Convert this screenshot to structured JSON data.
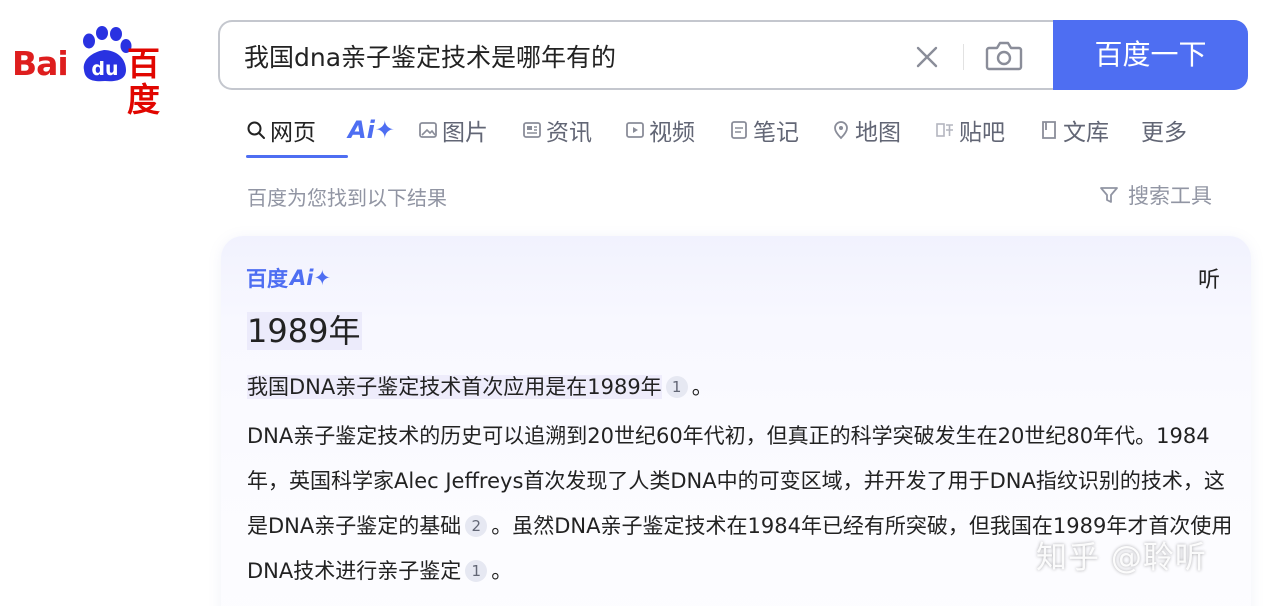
{
  "logo": {
    "bai": "Bai",
    "du": "du",
    "cn": "百度"
  },
  "search": {
    "query": "我国dna亲子鉴定技术是哪年有的",
    "button_label": "百度一下"
  },
  "tabs": [
    {
      "label": "网页",
      "icon": "search-icon",
      "active": true
    },
    {
      "label": "Ai✦",
      "icon": "ai-icon",
      "active": false
    },
    {
      "label": "图片",
      "icon": "image-icon",
      "active": false
    },
    {
      "label": "资讯",
      "icon": "news-icon",
      "active": false
    },
    {
      "label": "视频",
      "icon": "video-icon",
      "active": false
    },
    {
      "label": "笔记",
      "icon": "note-icon",
      "active": false
    },
    {
      "label": "地图",
      "icon": "map-icon",
      "active": false
    },
    {
      "label": "贴吧",
      "icon": "tieba-icon",
      "active": false
    },
    {
      "label": "文库",
      "icon": "wenku-icon",
      "active": false
    },
    {
      "label": "更多",
      "icon": "",
      "active": false
    }
  ],
  "results_info": "百度为您找到以下结果",
  "search_tools_label": "搜索工具",
  "ai_card": {
    "brand": "百度",
    "brand_ai": "Ai✦",
    "listen_label": "听",
    "title": "1989年",
    "summary_text": "我国DNA亲子鉴定技术首次应用是在1989年",
    "summary_cite": "1",
    "summary_end": "。",
    "para_part1": "DNA亲子鉴定技术的历史可以追溯到20世纪60年代初，但真正的科学突破发生在20世纪80年代。1984年，英国科学家Alec Jeffreys首次发现了人类DNA中的可变区域，并开发了用于DNA指纹识别的技术，这是DNA亲子鉴定的基础",
    "para_cite1": "2",
    "para_part2": "。虽然DNA亲子鉴定技术在1984年已经有所突破，但我国在1989年才首次使用DNA技术进行亲子鉴定",
    "para_cite2": "1",
    "para_end": "。"
  },
  "watermark": "知乎 @聆听",
  "colors": {
    "accent": "#4e6ef2",
    "logo_red": "#de1e1e",
    "muted": "#9195a3"
  }
}
